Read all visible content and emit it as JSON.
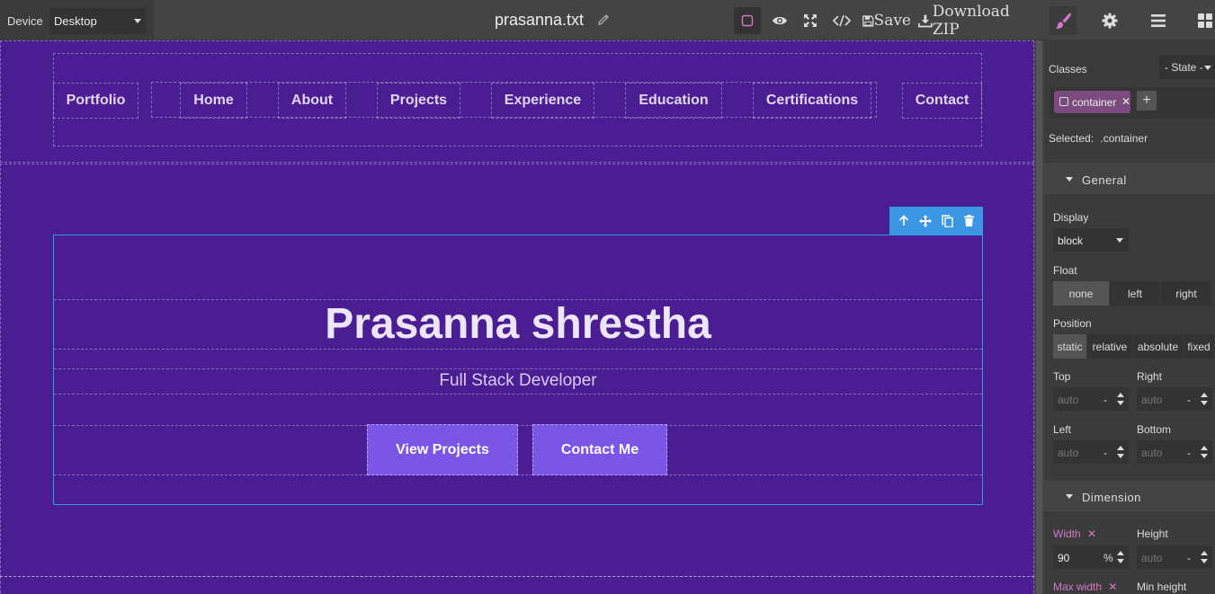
{
  "topbar": {
    "device_label": "Device",
    "device_value": "Desktop",
    "file_name": "prasanna.txt",
    "save_label": "Save",
    "download_label": "Download ZIP"
  },
  "page": {
    "nav": [
      "Portfolio",
      "Home",
      "About",
      "Projects",
      "Experience",
      "Education",
      "Certifications",
      "Contact"
    ],
    "hero_title": "Prasanna shrestha",
    "hero_subtitle": "Full Stack Developer",
    "cta_primary": "View Projects",
    "cta_secondary": "Contact Me"
  },
  "panel": {
    "classes_label": "Classes",
    "state_label": "- State -",
    "class_tag": "container",
    "selected_label": "Selected:",
    "selected_value": ".container",
    "general": {
      "title": "General",
      "display_label": "Display",
      "display_value": "block",
      "float_label": "Float",
      "float_options": [
        "none",
        "left",
        "right"
      ],
      "position_label": "Position",
      "position_options": [
        "static",
        "relative",
        "absolute",
        "fixed"
      ],
      "top_label": "Top",
      "right_label": "Right",
      "left_label": "Left",
      "bottom_label": "Bottom",
      "auto": "auto",
      "dash": "-"
    },
    "dimension": {
      "title": "Dimension",
      "width_label": "Width",
      "width_value": "90",
      "width_unit": "%",
      "height_label": "Height",
      "height_value": "auto",
      "max_width_label": "Max width",
      "min_height_label": "Min height"
    }
  },
  "colors": {
    "canvas_bg": "#4b1d93",
    "button_bg": "#7a55e6",
    "selection": "#2d9ee6",
    "modified_prop": "#d278c9"
  }
}
